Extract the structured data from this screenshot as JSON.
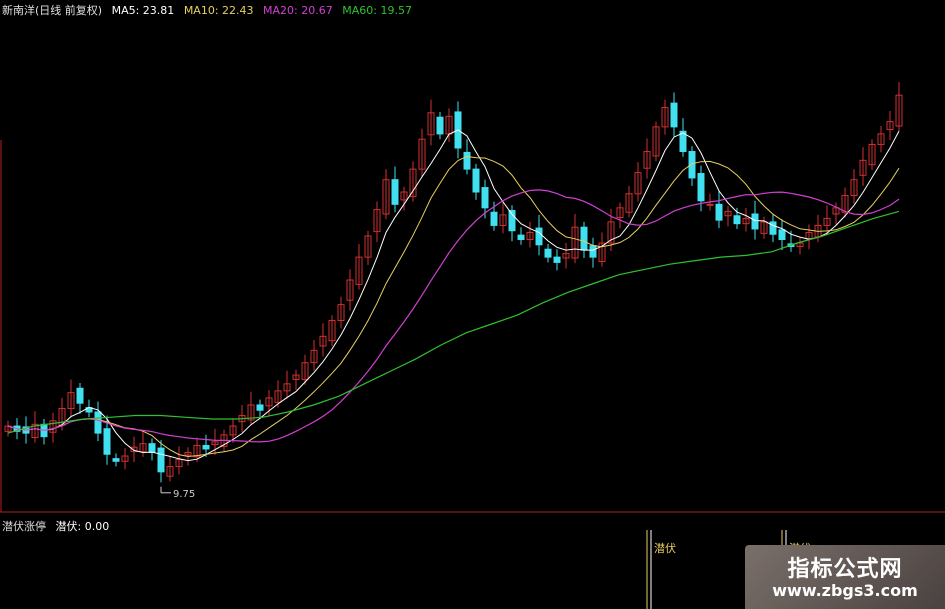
{
  "header": {
    "stock": "新南洋(日线 前复权)",
    "ma5": "MA5: 23.81",
    "ma10": "MA10: 22.43",
    "ma20": "MA20: 20.67",
    "ma60": "MA60: 19.57"
  },
  "sub_panel": {
    "indicator": "潜伏涨停",
    "value": "潜伏: 0.00",
    "signal_label_1": "潜伏",
    "signal_label_2": "潜伏"
  },
  "price_low_label": "9.75",
  "watermark": {
    "title": "指标公式网",
    "url": "www.zbgs3.com"
  },
  "colors": {
    "up_candle": "#d03030",
    "down_candle": "#40e0f0",
    "ma5": "#ffffff",
    "ma10": "#e8d060",
    "ma20": "#d040d0",
    "ma60": "#30c030",
    "panel_border": "#b02020",
    "signal": "#e8d060"
  },
  "chart_data": {
    "type": "candlestick",
    "closes": [
      13.2,
      12.9,
      12.8,
      13.3,
      12.6,
      13.5,
      14.2,
      15.1,
      14.5,
      14.0,
      12.8,
      11.6,
      11.2,
      11.5,
      12.0,
      12.2,
      11.7,
      10.6,
      10.9,
      11.3,
      11.7,
      12.1,
      11.9,
      12.3,
      12.7,
      13.2,
      13.8,
      14.4,
      14.1,
      14.8,
      15.2,
      15.6,
      16.1,
      16.8,
      17.5,
      18.3,
      19.2,
      20.1,
      21.5,
      22.8,
      24.0,
      25.5,
      27.2,
      25.8,
      26.5,
      27.8,
      29.5,
      31.0,
      29.8,
      30.8,
      29.0,
      27.8,
      26.5,
      25.6,
      24.6,
      25.2,
      24.3,
      23.8,
      24.2,
      23.5,
      22.8,
      22.5,
      23.0,
      24.5,
      23.2,
      22.8,
      23.6,
      24.8,
      25.6,
      26.4,
      27.6,
      28.8,
      30.2,
      31.3,
      30.2,
      28.8,
      27.3,
      26.0,
      25.8,
      24.9,
      25.4,
      24.7,
      25.0,
      24.4,
      24.8,
      24.1,
      23.8,
      23.4,
      23.6,
      24.2,
      24.6,
      25.0,
      25.6,
      26.3,
      27.2,
      28.3,
      29.2,
      29.8,
      30.5,
      32.0
    ],
    "ma60_values": [
      12.8,
      13.2,
      13.4,
      13.6,
      13.7,
      13.8,
      13.8,
      13.7,
      13.6,
      13.6,
      13.7,
      14.0,
      14.4,
      14.9,
      15.6,
      16.3,
      17.0,
      17.8,
      18.5,
      19.0,
      19.5,
      20.2,
      20.8,
      21.3,
      21.8,
      22.1,
      22.4,
      22.6,
      22.8,
      22.9,
      23.1,
      23.6,
      24.0,
      24.5,
      25.0,
      25.4
    ],
    "low_marker": 9.75,
    "series": [
      {
        "name": "MA5"
      },
      {
        "name": "MA10"
      },
      {
        "name": "MA20"
      },
      {
        "name": "MA60"
      }
    ],
    "ylim": [
      9.0,
      34.0
    ],
    "signal_positions": [
      71,
      86
    ]
  }
}
